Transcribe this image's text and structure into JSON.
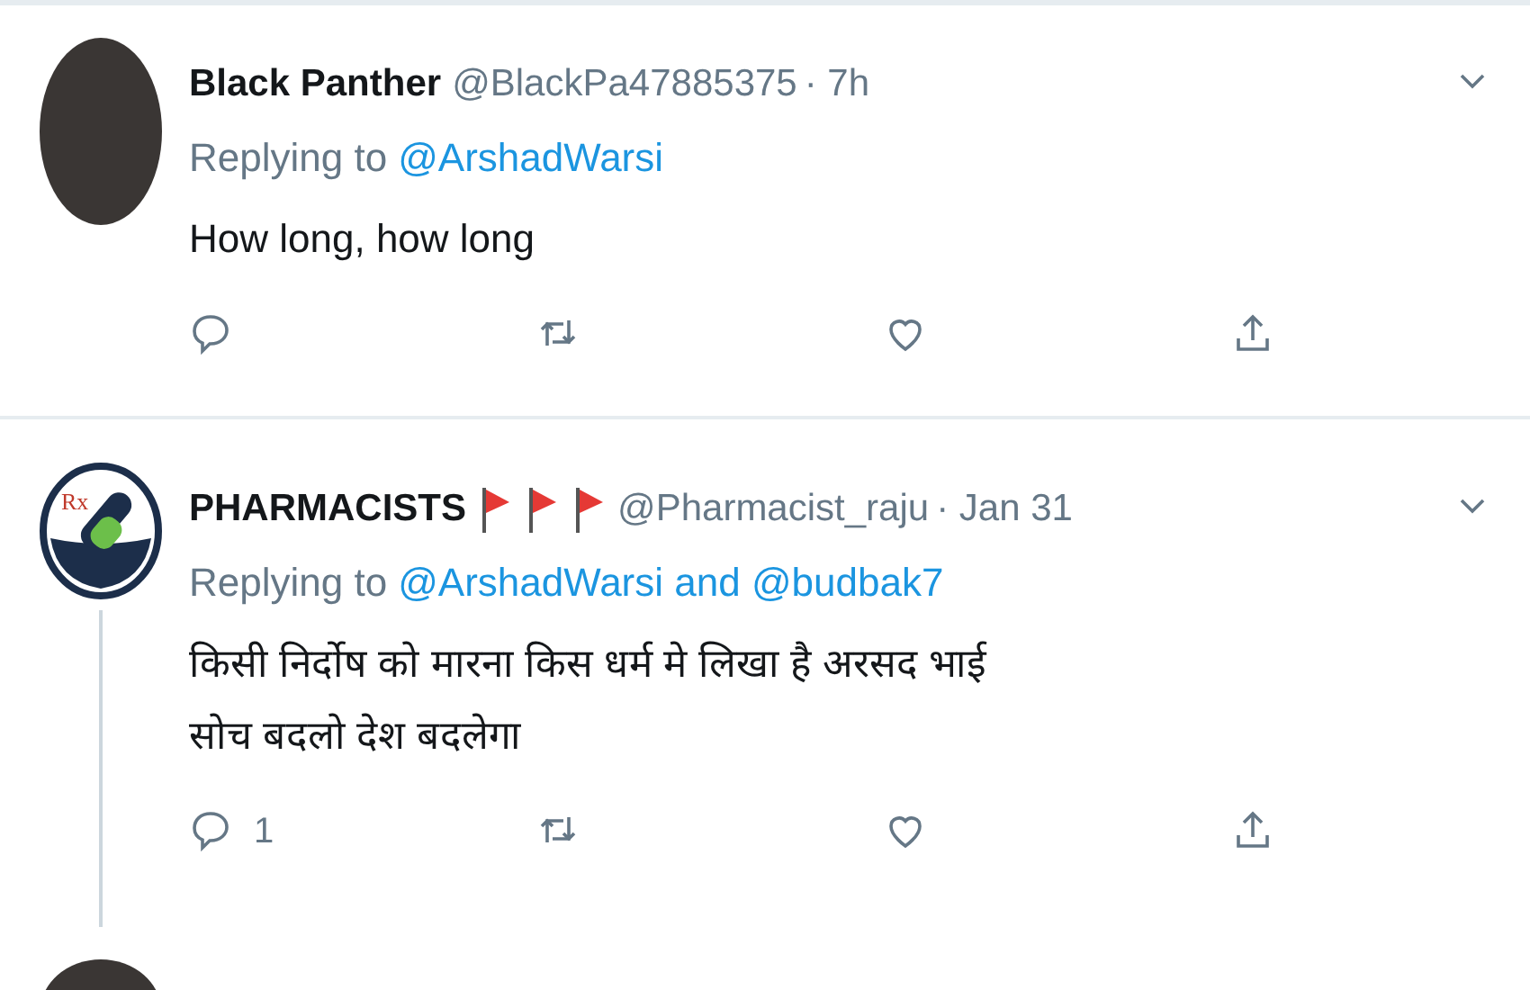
{
  "tweets": [
    {
      "avatar": {
        "kind": "photo"
      },
      "name": "Black Panther",
      "handle": "@BlackPa47885375",
      "time": "· 7h",
      "replying_prefix": "Replying to",
      "reply_to": "@ArshadWarsi",
      "body": [
        "How long, how long"
      ],
      "thread_line": false
    },
    {
      "avatar": {
        "kind": "logo",
        "text": "Rx"
      },
      "name": "PHARMACISTS",
      "badges": [
        {
          "kind": "flag"
        },
        {
          "kind": "flag"
        },
        {
          "kind": "flag"
        }
      ],
      "handle": "@Pharmacist_raju",
      "time": "· Jan 31",
      "replying_prefix": "Replying to",
      "reply_to": "@ArshadWarsi and @budbak7",
      "body": [
        "किसी निर्दोष को मारना किस धर्म मे लिखा है अरसद भाई",
        "सोच बदलो देश बदलेगा"
      ],
      "reply_count": "1",
      "thread_line": true
    },
    {
      "avatar": {
        "kind": "photo"
      },
      "partial": true
    }
  ]
}
